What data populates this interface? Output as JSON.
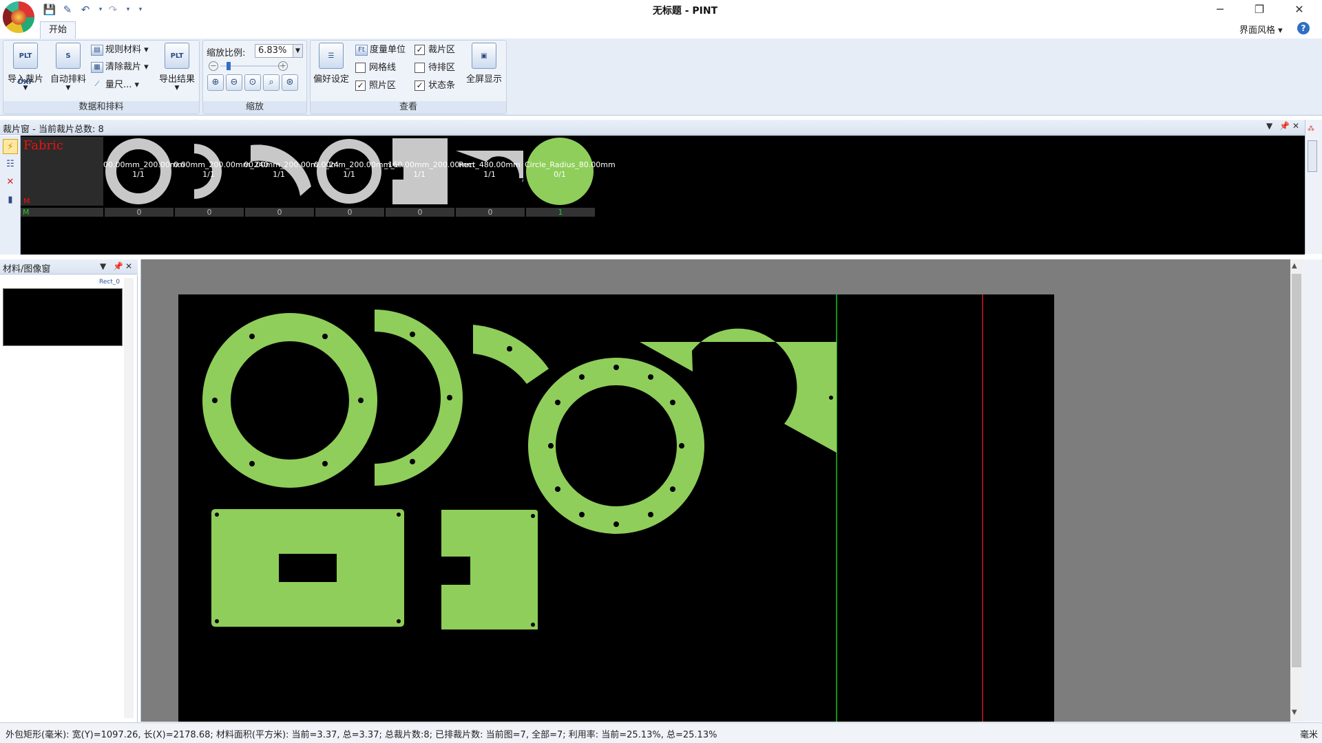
{
  "window": {
    "title": "无标题 - PINT",
    "minimize": "─",
    "restore": "❐",
    "close": "✕"
  },
  "quick_access": {
    "save_icon": "💾",
    "open_icon": "✎",
    "undo_icon": "↶",
    "redo_icon": "↷",
    "more_icon": "▾"
  },
  "ribbon": {
    "tab": "开始",
    "style_menu": "界面风格 ▾",
    "help": "?",
    "groups": {
      "data": {
        "label": "数据和排料",
        "import": "导入裁片",
        "auto_nest": "自动排料",
        "rule_material": "规则材料 ▾",
        "clear_pieces": "清除裁片 ▾",
        "ruler": "量尺... ▾",
        "export": "导出结果",
        "import_icon": "PLT DXF",
        "export_icon": "PLT"
      },
      "zoom": {
        "label": "缩放",
        "ratio_label": "缩放比例:",
        "ratio_value": "6.83%"
      },
      "view": {
        "label": "查看",
        "preferences": "偏好设定",
        "measure_unit": "度量单位",
        "grid": "网格线",
        "photo_area": "照片区",
        "piece_area": "裁片区",
        "pending_area": "待排区",
        "status_bar": "状态条",
        "fullscreen": "全屏显示"
      }
    }
  },
  "piece_window": {
    "title": "裁片窗 - 当前裁片总数: 8",
    "fabric_label": "Fabric",
    "fabric_m": "M",
    "fabric_row": "M",
    "pieces": [
      {
        "name": "00.00mm_200.00mm",
        "qty": "1/1",
        "count": "0"
      },
      {
        "name": "0.00mm_200.00mm_240",
        "qty": "1/1",
        "count": "0"
      },
      {
        "name": "00.00mm_200.00mm_24",
        "qty": "1/1",
        "count": "0"
      },
      {
        "name": "0.00mm_200.00mm_240.00mm",
        "qty": "1/1",
        "count": "0"
      },
      {
        "name": "_160.00mm_200.00mm",
        "qty": "1/1",
        "count": "0"
      },
      {
        "name": "Rect_480.00mm",
        "qty": "1/1",
        "count": "0"
      },
      {
        "name": "Circle_Radius_80.00mm",
        "qty": "0/1",
        "count": "1"
      }
    ]
  },
  "material_window": {
    "title": "材料/图像窗",
    "thumb_label": "Rect_0"
  },
  "status": {
    "text": "外包矩形(毫米): 宽(Y)=1097.26, 长(X)=2178.68; 材料面积(平方米): 当前=3.37, 总=3.37; 总裁片数:8; 已排裁片数: 当前图=7, 全部=7; 利用率: 当前=25.13%, 总=25.13%",
    "unit": "毫米"
  },
  "colors": {
    "piece_fill": "#8fce5a",
    "sheet_bg": "#000000",
    "canvas_bg": "#7d7d7d",
    "green_line": "#1fbf1f",
    "red_line": "#d11a1a"
  }
}
